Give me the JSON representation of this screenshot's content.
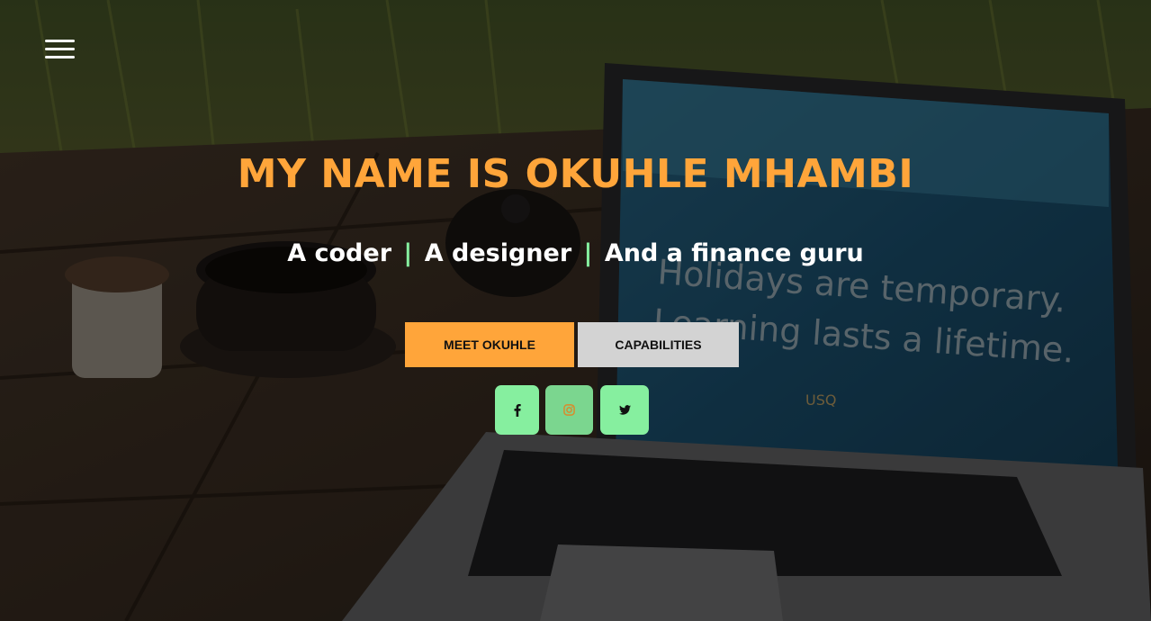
{
  "hero": {
    "title": "MY NAME IS OKUHLE MHAMBI",
    "tagline": {
      "part1": "A coder",
      "separator": "|",
      "part2": "A designer",
      "part3": "And a finance guru"
    },
    "buttons": {
      "meet": "MEET OKUHLE",
      "capabilities": "CAPABILITIES"
    },
    "social": [
      {
        "icon": "facebook-icon"
      },
      {
        "icon": "instagram-icon"
      },
      {
        "icon": "twitter-icon"
      }
    ]
  },
  "background": {
    "screen_text_line1": "Holidays are temporary.",
    "screen_text_line2": "Learning lasts a lifetime.",
    "screen_logo": "USQ"
  },
  "colors": {
    "accent": "#ffa53a",
    "separator": "#86ef9f",
    "social_bg": "#86ef9f",
    "secondary_button": "#d3d3d3"
  }
}
